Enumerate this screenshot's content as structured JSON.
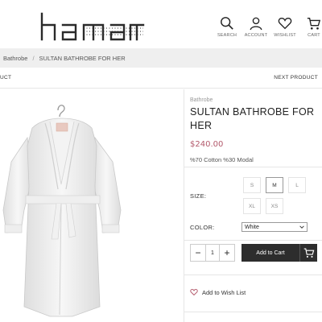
{
  "header": {
    "logo_text": "hamam",
    "nav": [
      {
        "label": "SEARCH",
        "icon": "search-icon"
      },
      {
        "label": "ACCOUNT",
        "icon": "user-icon"
      },
      {
        "label": "WISHLIST",
        "icon": "heart-icon"
      },
      {
        "label": "CART",
        "icon": "cart-icon"
      }
    ]
  },
  "breadcrumb": {
    "items": [
      "Bathrobe",
      "SULTAN BATHROBE FOR HER"
    ],
    "separator": "/"
  },
  "pager": {
    "prev": "UCT",
    "next": "NEXT PRODUCT"
  },
  "product": {
    "category": "Bathrobe",
    "title": "SULTAN BATHROBE FOR HER",
    "price": "$240.00",
    "material": "%70 Cotton %30 Modal",
    "price_color": "#b35a6c"
  },
  "options": {
    "size_label": "SIZE:",
    "sizes": [
      "S",
      "M",
      "L",
      "XL",
      "XS"
    ],
    "selected_size": "M",
    "color_label": "COLOR:",
    "color_value": "White"
  },
  "cart": {
    "minus": "−",
    "qty": "1",
    "plus": "+",
    "add_label": "Add to Cart"
  },
  "wishlist": {
    "label": "Add to Wish List"
  }
}
